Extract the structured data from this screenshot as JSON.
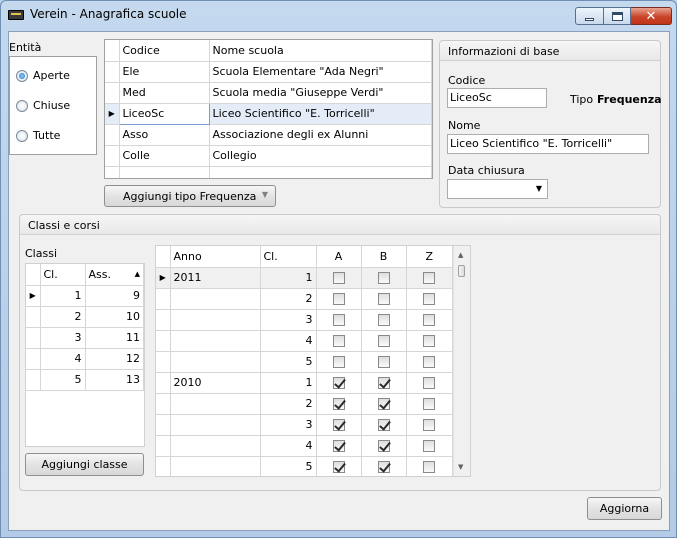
{
  "window": {
    "title": "Verein - Anagrafica scuole",
    "min_icon": "minimize-icon",
    "max_icon": "maximize-icon",
    "close_icon": "close-icon"
  },
  "entita": {
    "label": "Entità",
    "options": [
      {
        "label": "Aperte",
        "checked": true
      },
      {
        "label": "Chiuse",
        "checked": false
      },
      {
        "label": "Tutte",
        "checked": false
      }
    ]
  },
  "schools": {
    "columns": [
      "Codice",
      "Nome scuola"
    ],
    "rows": [
      {
        "codice": "Ele",
        "nome": "Scuola Elementare \"Ada Negri\""
      },
      {
        "codice": "Med",
        "nome": "Scuola media \"Giuseppe Verdi\""
      },
      {
        "codice": "LiceoSc",
        "nome": "Liceo Scientifico \"E. Torricelli\"",
        "selected": true
      },
      {
        "codice": "Asso",
        "nome": "Associazione degli ex Alunni"
      },
      {
        "codice": "Colle",
        "nome": "Collegio"
      }
    ]
  },
  "add_type_button": "Aggiungi tipo Frequenza",
  "info": {
    "header": "Informazioni di base",
    "codice_label": "Codice",
    "codice_value": "LiceoSc",
    "tipo_label": "Tipo",
    "tipo_value": "Frequenza",
    "nome_label": "Nome",
    "nome_value": "Liceo Scientifico \"E. Torricelli\"",
    "chiusura_label": "Data chiusura",
    "chiusura_value": ""
  },
  "classi_corsi": {
    "header": "Classi e corsi",
    "classi_label": "Classi",
    "classi_columns": [
      "Cl.",
      "Ass."
    ],
    "classi_rows": [
      {
        "cl": "1",
        "ass": "9"
      },
      {
        "cl": "2",
        "ass": "10"
      },
      {
        "cl": "3",
        "ass": "11"
      },
      {
        "cl": "4",
        "ass": "12"
      },
      {
        "cl": "5",
        "ass": "13"
      }
    ],
    "add_class_button": "Aggiungi classe",
    "corsi_columns": [
      "Anno",
      "Cl.",
      "A",
      "B",
      "Z"
    ],
    "corsi_rows": [
      {
        "anno": "2011",
        "cl": "1",
        "a": false,
        "b": false,
        "z": false
      },
      {
        "anno": "",
        "cl": "2",
        "a": false,
        "b": false,
        "z": false
      },
      {
        "anno": "",
        "cl": "3",
        "a": false,
        "b": false,
        "z": false
      },
      {
        "anno": "",
        "cl": "4",
        "a": false,
        "b": false,
        "z": false
      },
      {
        "anno": "",
        "cl": "5",
        "a": false,
        "b": false,
        "z": false
      },
      {
        "anno": "2010",
        "cl": "1",
        "a": true,
        "b": true,
        "z": false
      },
      {
        "anno": "",
        "cl": "2",
        "a": true,
        "b": true,
        "z": false
      },
      {
        "anno": "",
        "cl": "3",
        "a": true,
        "b": true,
        "z": false
      },
      {
        "anno": "",
        "cl": "4",
        "a": true,
        "b": true,
        "z": false
      },
      {
        "anno": "",
        "cl": "5",
        "a": true,
        "b": true,
        "z": false
      }
    ]
  },
  "update_button": "Aggiorna"
}
